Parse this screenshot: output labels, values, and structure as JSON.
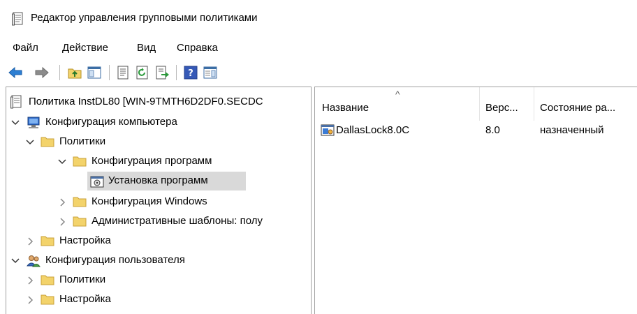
{
  "window": {
    "title": "Редактор управления групповыми политиками"
  },
  "menu": {
    "items": [
      "Файл",
      "Действие",
      "Вид",
      "Справка"
    ]
  },
  "toolbar": {
    "buttons": [
      "back-icon",
      "forward-icon",
      "up-folder-icon",
      "show-hide-tree-icon",
      "properties-icon",
      "refresh-icon",
      "export-list-icon",
      "help-icon",
      "show-action-pane-icon"
    ]
  },
  "tree": {
    "root": "Политика InstDL80 [WIN-9TMTH6D2DF0.SECDC",
    "computer_config": "Конфигурация компьютера",
    "comp_policies": "Политики",
    "software_settings": "Конфигурация программ",
    "software_install": "Установка программ",
    "windows_settings": "Конфигурация Windows",
    "admin_templates": "Административные шаблоны: полу",
    "comp_preferences": "Настройка",
    "user_config": "Конфигурация пользователя",
    "user_policies": "Политики",
    "user_preferences": "Настройка"
  },
  "list": {
    "columns": [
      "Название",
      "Верс...",
      "Состояние ра..."
    ],
    "sort_indicator": "^",
    "rows": [
      {
        "name": "DallasLock8.0C",
        "version": "8.0",
        "state": "назначенный"
      }
    ]
  },
  "colors": {
    "selection": "#d9d9d9",
    "border": "#a0a0a0",
    "folder": "#f3d36b",
    "nav_arrow": "#2d7fd3"
  }
}
